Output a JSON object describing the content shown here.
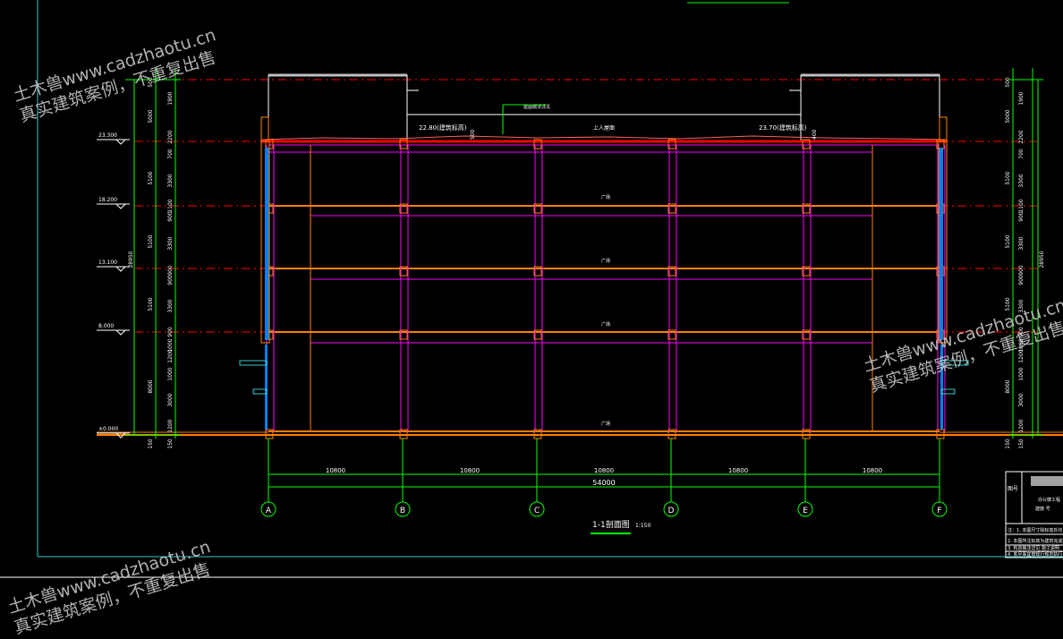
{
  "levels": [
    {
      "label": "23.300"
    },
    {
      "label": "18.200"
    },
    {
      "label": "13.100"
    },
    {
      "label": "8.000"
    },
    {
      "label": "±0.000"
    }
  ],
  "left_dims": {
    "outer": [
      "500",
      "5000",
      "5100",
      "5100",
      "5100",
      "8000",
      "150"
    ],
    "inner": [
      "1900",
      "2200",
      "700",
      "3300",
      "1100",
      "900",
      "3300",
      "900",
      "900",
      "3300",
      "900",
      "1000",
      "1200",
      "1000",
      "3000",
      "1200",
      "150"
    ],
    "total": "28950"
  },
  "right_dims": {
    "outer": [
      "500",
      "5000",
      "5100",
      "5100",
      "5100",
      "8000",
      "150"
    ],
    "inner": [
      "1900",
      "2200",
      "700",
      "3300",
      "1100",
      "900",
      "3300",
      "900",
      "900",
      "3300",
      "900",
      "1000",
      "1200",
      "1000",
      "3000",
      "1200",
      "150"
    ],
    "total": "28950"
  },
  "roof": {
    "elev_left": "22.80(建筑标高)",
    "elev_right": "23.70(建筑标高)",
    "mid_label": "上人屋面",
    "note": "屋面做法详见",
    "dim_left": "500",
    "dim_right": "400"
  },
  "room_labels": [
    "广场",
    "广场",
    "广场",
    "广场"
  ],
  "bay_dims": [
    "10800",
    "10800",
    "10800",
    "10800",
    "10800"
  ],
  "total_dim": "54000",
  "axes": [
    "A",
    "B",
    "C",
    "D",
    "E",
    "F"
  ],
  "section_title": "1-1剖面图",
  "section_scale": "1:150",
  "title_block": {
    "label": "图号",
    "project": "办公楼工程",
    "code": "建施  号",
    "notes": [
      "注：1. 本图尺寸除标高外均以毫米计",
      "2. 本图所注标高为建筑完成面",
      "3. 构造做法详见     施工说明",
      "4. 未尽事宜按现行规范执行"
    ]
  },
  "watermark": {
    "line1": "土木兽www.cadzhaotu.cn",
    "line2": "真实建筑案例，不重复出售"
  },
  "colors": {
    "frame": "#33cccc",
    "dim": "#00ff00",
    "level": "#ff0000",
    "column": "#ff00ff",
    "beam": "#ff8000",
    "glass": "#00a0ff",
    "text": "#ffffff"
  }
}
